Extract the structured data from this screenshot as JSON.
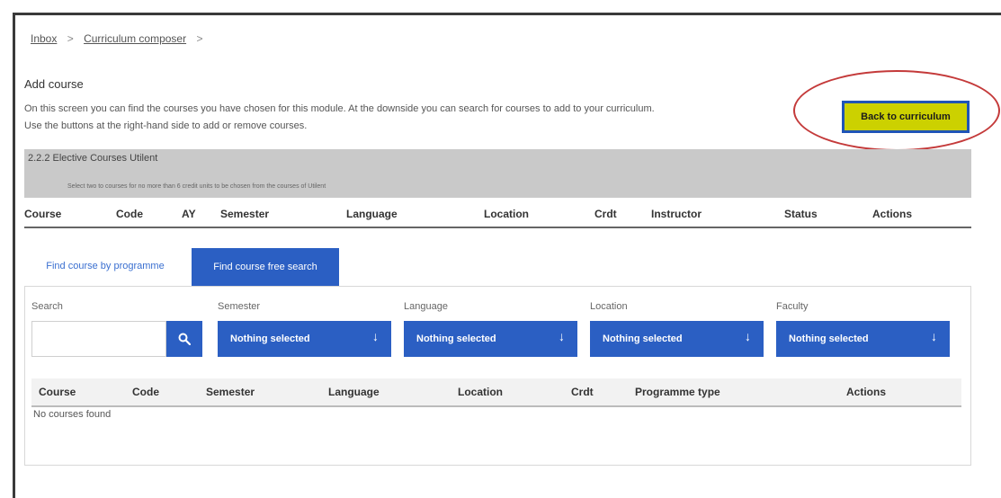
{
  "breadcrumb": {
    "items": [
      "Inbox",
      "Curriculum composer"
    ],
    "separator": ">"
  },
  "page": {
    "title": "Add course",
    "intro_line1": "On this screen you can find the courses you have chosen for this module. At the downside you can search for courses to add to your curriculum.",
    "intro_line2": "Use the buttons at the right-hand side to add or remove courses."
  },
  "back_button": {
    "label": "Back to curriculum"
  },
  "module": {
    "title": "2.2.2 Elective Courses Utilent",
    "note": "Select two to courses for no more than 6 credit units to be chosen from the courses of Utilent"
  },
  "selected_table": {
    "columns": [
      "Course",
      "Code",
      "AY",
      "Semester",
      "Language",
      "Location",
      "Crdt",
      "Instructor",
      "Status",
      "Actions"
    ]
  },
  "tabs": [
    {
      "label": "Find course by programme",
      "active": false
    },
    {
      "label": "Find course free search",
      "active": true
    }
  ],
  "filters": {
    "search": {
      "label": "Search",
      "value": "",
      "placeholder": ""
    },
    "semester": {
      "label": "Semester",
      "value": "Nothing selected"
    },
    "language": {
      "label": "Language",
      "value": "Nothing selected"
    },
    "location": {
      "label": "Location",
      "value": "Nothing selected"
    },
    "faculty": {
      "label": "Faculty",
      "value": "Nothing selected"
    }
  },
  "results_table": {
    "columns": [
      "Course",
      "Code",
      "Semester",
      "Language",
      "Location",
      "Crdt",
      "Programme type",
      "Actions"
    ],
    "empty_text": "No courses found"
  },
  "icons": {
    "search": "search-icon",
    "dropdown": "chevron-down-icon"
  },
  "colors": {
    "primary": "#2b5fc3",
    "back_button_bg": "#ccd100",
    "annotation": "#c43a3a",
    "module_bg": "#c9c9c9"
  }
}
